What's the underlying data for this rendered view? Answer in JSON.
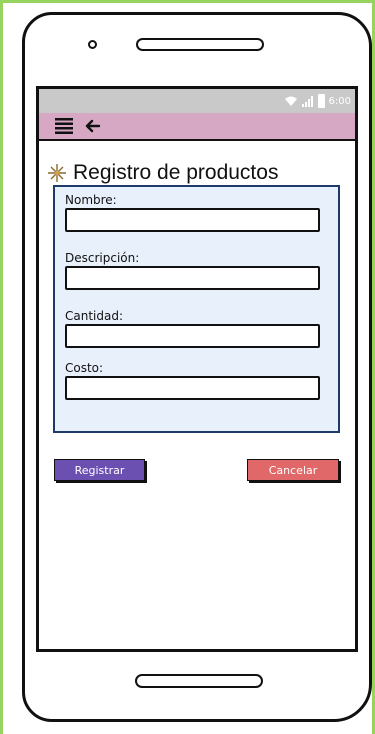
{
  "statusbar": {
    "time": "6:00"
  },
  "appbar": {
    "menu_icon": "menu-icon",
    "back_icon": "back-arrow-icon"
  },
  "header": {
    "title": "Registro de productos",
    "icon": "sparkle-icon"
  },
  "form": {
    "fields": [
      {
        "label": "Nombre:",
        "value": ""
      },
      {
        "label": "Descripción:",
        "value": ""
      },
      {
        "label": "Cantidad:",
        "value": ""
      },
      {
        "label": "Costo:",
        "value": ""
      }
    ]
  },
  "actions": {
    "register_label": "Registrar",
    "cancel_label": "Cancelar"
  },
  "colors": {
    "frame_border": "#96d35f",
    "appbar": "#d6a8c4",
    "statusbar": "#c9c9c9",
    "form_panel": "#e8f0fb",
    "register_button": "#6b4fb1",
    "cancel_button": "#e06868"
  }
}
